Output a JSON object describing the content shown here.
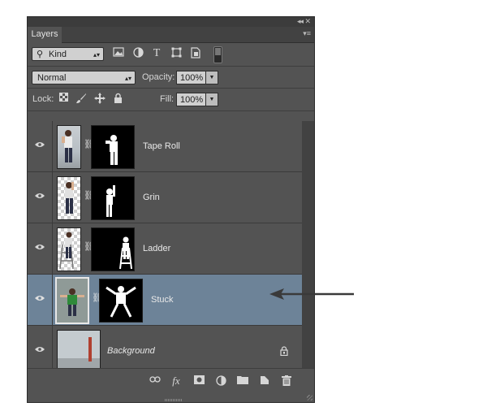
{
  "panel": {
    "tab_title": "Layers",
    "collapse_glyph": "◂◂",
    "close_glyph": "✕",
    "menu_glyph": "▾≡"
  },
  "filter": {
    "kind_label": "Kind",
    "icons": [
      "image-filter-icon",
      "adjustment-filter-icon",
      "type-filter-icon",
      "shape-filter-icon",
      "smart-object-filter-icon"
    ]
  },
  "blend": {
    "mode": "Normal",
    "opacity_label": "Opacity:",
    "opacity_value": "100%",
    "lock_label": "Lock:",
    "fill_label": "Fill:",
    "fill_value": "100%"
  },
  "layers": [
    {
      "name": "Tape Roll",
      "selected": false
    },
    {
      "name": "Grin",
      "selected": false
    },
    {
      "name": "Ladder",
      "selected": false
    },
    {
      "name": "Stuck",
      "selected": true
    },
    {
      "name": "Background",
      "selected": false,
      "locked": true
    }
  ],
  "bottom_toolbar": [
    "link-layers-icon",
    "fx-icon",
    "add-mask-icon",
    "adjustment-layer-icon",
    "new-group-icon",
    "new-layer-icon",
    "delete-layer-icon"
  ],
  "colors": {
    "panel_bg": "#535353",
    "selected_row": "#6d8398",
    "arrow": "#3a3a3a"
  }
}
